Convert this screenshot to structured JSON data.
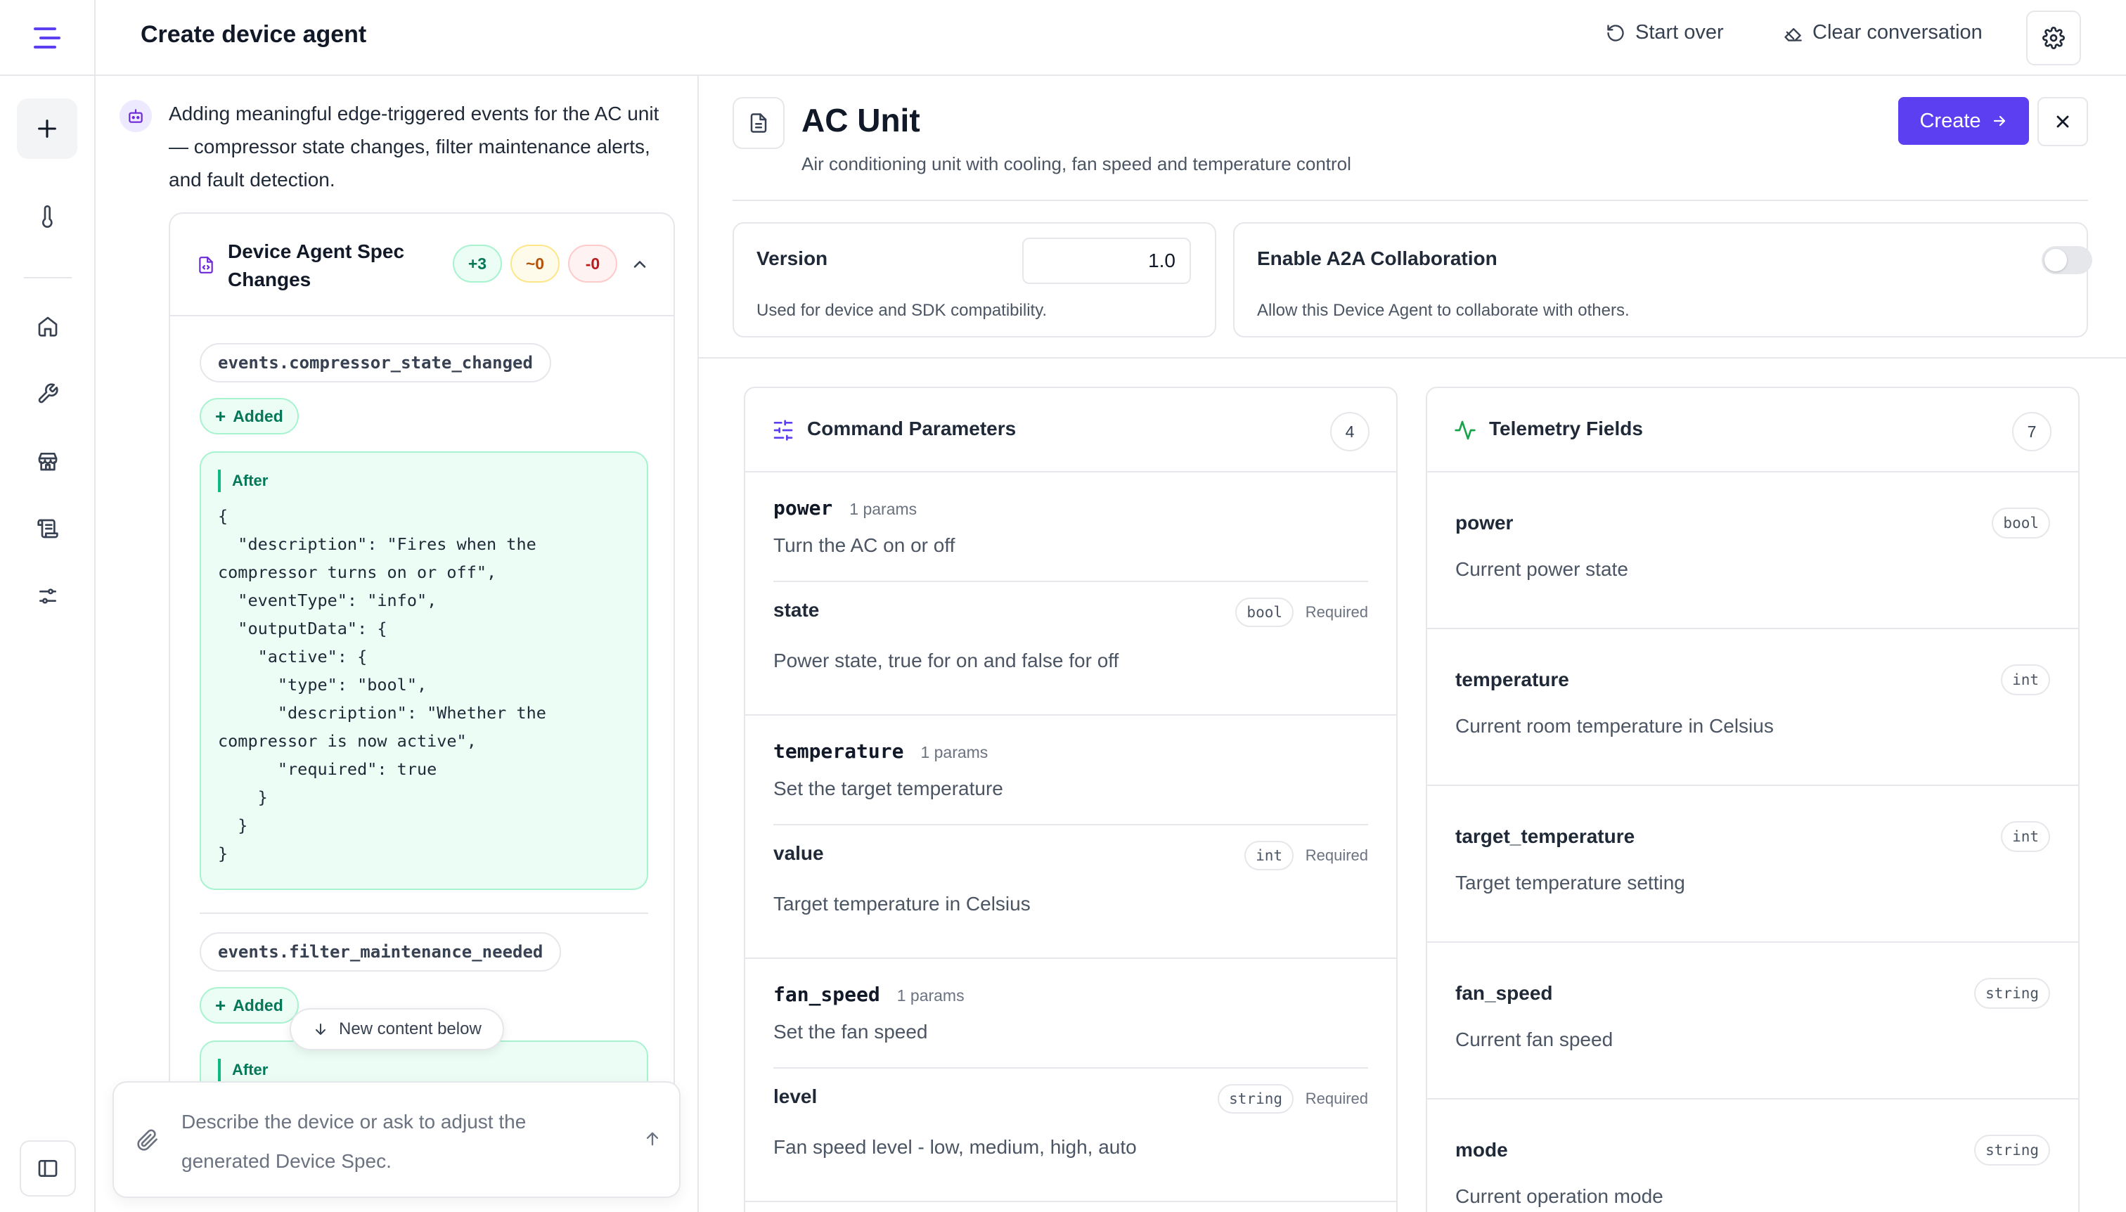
{
  "header": {
    "title": "Create device agent",
    "start_over": "Start over",
    "clear_conversation": "Clear conversation"
  },
  "chat": {
    "message": "Adding meaningful edge-triggered events for the AC unit — compressor state changes, filter maintenance alerts, and fault detection.",
    "spec_card": {
      "title": "Device Agent Spec Changes",
      "added_count": "+3",
      "modified_count": "~0",
      "removed_count": "-0",
      "changes": [
        {
          "key": "events.compressor_state_changed",
          "status": "Added",
          "after_label": "After",
          "code": "{\n  \"description\": \"Fires when the compressor turns on or off\",\n  \"eventType\": \"info\",\n  \"outputData\": {\n    \"active\": {\n      \"type\": \"bool\",\n      \"description\": \"Whether the compressor is now active\",\n      \"required\": true\n    }\n  }\n}"
        },
        {
          "key": "events.filter_maintenance_needed",
          "status": "Added",
          "after_label": "After"
        }
      ]
    },
    "new_content": "New content below",
    "composer_placeholder": "Describe the device or ask to adjust the generated Device Spec."
  },
  "agent": {
    "name": "AC Unit",
    "description": "Air conditioning unit with cooling, fan speed and temperature control",
    "create_label": "Create",
    "version": {
      "label": "Version",
      "value": "1.0",
      "help": "Used for device and SDK compatibility."
    },
    "a2a": {
      "label": "Enable A2A Collaboration",
      "help": "Allow this Device Agent to collaborate with others.",
      "enabled": false
    }
  },
  "commands": {
    "title": "Command Parameters",
    "count": "4",
    "items": [
      {
        "name": "power",
        "param_count": "1 params",
        "description": "Turn the AC on or off",
        "param": {
          "name": "state",
          "type": "bool",
          "required": "Required",
          "description": "Power state, true for on and false for off"
        }
      },
      {
        "name": "temperature",
        "param_count": "1 params",
        "description": "Set the target temperature",
        "param": {
          "name": "value",
          "type": "int",
          "required": "Required",
          "description": "Target temperature in Celsius"
        }
      },
      {
        "name": "fan_speed",
        "param_count": "1 params",
        "description": "Set the fan speed",
        "param": {
          "name": "level",
          "type": "string",
          "required": "Required",
          "description": "Fan speed level - low, medium, high, auto"
        }
      }
    ]
  },
  "telemetry": {
    "title": "Telemetry Fields",
    "count": "7",
    "items": [
      {
        "name": "power",
        "type": "bool",
        "description": "Current power state"
      },
      {
        "name": "temperature",
        "type": "int",
        "description": "Current room temperature in Celsius"
      },
      {
        "name": "target_temperature",
        "type": "int",
        "description": "Target temperature setting"
      },
      {
        "name": "fan_speed",
        "type": "string",
        "description": "Current fan speed"
      },
      {
        "name": "mode",
        "type": "string",
        "description": "Current operation mode"
      }
    ]
  },
  "colors": {
    "accent": "#5b3ff0",
    "added_bg": "#ecfdf5",
    "added_border": "#a7f3d0",
    "added_text": "#047857"
  },
  "icons": {
    "logo": "menu-lines-icon",
    "start_over": "rotate-ccw-icon",
    "clear": "eraser-icon",
    "settings": "gear-icon",
    "new": "plus-icon",
    "thermometer": "thermometer-icon",
    "home": "home-icon",
    "tools": "wrench-icon",
    "store": "store-icon",
    "docs": "scroll-icon",
    "sliders": "sliders-icon",
    "panel": "sidebar-icon",
    "bot": "bot-icon",
    "file": "file-icon",
    "arrow_right": "arrow-right-icon",
    "close": "close-icon",
    "commands": "sliders-horizontal-icon",
    "telemetry": "activity-icon",
    "attach": "paperclip-icon",
    "send": "arrow-up-icon",
    "down": "arrow-down-icon",
    "chevron": "chevron-up-icon"
  }
}
